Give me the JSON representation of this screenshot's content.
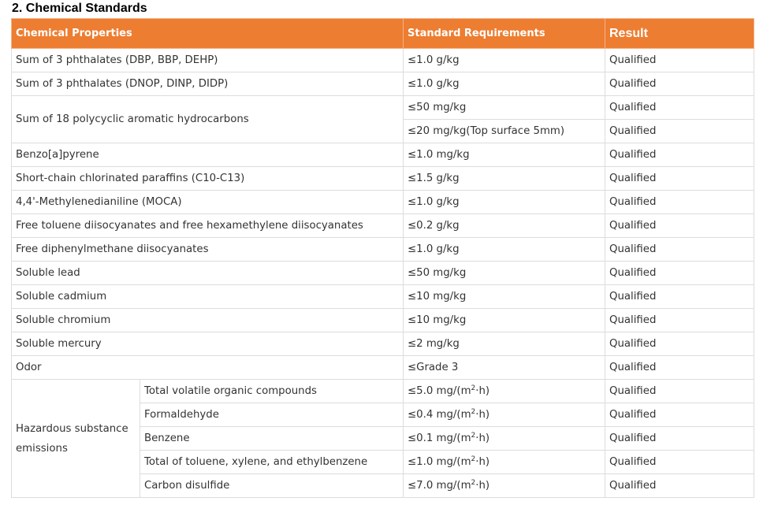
{
  "section_title": "2. Chemical Standards",
  "headers": {
    "property": "Chemical Properties",
    "requirement": "Standard Requirements",
    "result": "Result"
  },
  "rows": [
    {
      "property": "Sum of 3 phthalates (DBP, BBP, DEHP)",
      "requirement": "≤1.0 g/kg",
      "result": "Qualified"
    },
    {
      "property": "Sum of 3 phthalates (DNOP, DINP, DIDP)",
      "requirement": "≤1.0 g/kg",
      "result": "Qualified"
    },
    {
      "property": "Sum of 18 polycyclic aromatic hydrocarbons",
      "requirements": [
        {
          "requirement": "≤50 mg/kg",
          "result": "Qualified"
        },
        {
          "requirement": "≤20 mg/kg(Top surface 5mm)",
          "result": "Qualified"
        }
      ]
    },
    {
      "property": "Benzo[a]pyrene",
      "requirement": "≤1.0 mg/kg",
      "result": "Qualified"
    },
    {
      "property": "Short-chain chlorinated paraffins (C10-C13)",
      "requirement": "≤1.5 g/kg",
      "result": "Qualified"
    },
    {
      "property": "4,4'-Methylenedianiline (MOCA)",
      "requirement": "≤1.0 g/kg",
      "result": "Qualified"
    },
    {
      "property": "Free toluene diisocyanates and free hexamethylene diisocyanates",
      "requirement": "≤0.2 g/kg",
      "result": "Qualified"
    },
    {
      "property": "Free diphenylmethane diisocyanates",
      "requirement": "≤1.0 g/kg",
      "result": "Qualified"
    },
    {
      "property": "Soluble lead",
      "requirement": "≤50 mg/kg",
      "result": "Qualified"
    },
    {
      "property": "Soluble cadmium",
      "requirement": "≤10 mg/kg",
      "result": "Qualified"
    },
    {
      "property": "Soluble chromium",
      "requirement": "≤10 mg/kg",
      "result": "Qualified"
    },
    {
      "property": "Soluble mercury",
      "requirement": "≤2 mg/kg",
      "result": "Qualified"
    },
    {
      "property": "Odor",
      "requirement": "≤Grade 3",
      "result": "Qualified"
    }
  ],
  "emissions": {
    "group_label": "Hazardous substance emissions",
    "unit_exponent": "2",
    "items": [
      {
        "substance": "Total volatile organic compounds",
        "req_prefix": "≤5.0 mg/(m",
        "req_suffix": "·h)",
        "result": "Qualified"
      },
      {
        "substance": "Formaldehyde",
        "req_prefix": "≤0.4 mg/(m",
        "req_suffix": "·h)",
        "result": "Qualified"
      },
      {
        "substance": "Benzene",
        "req_prefix": "≤0.1 mg/(m",
        "req_suffix": "·h)",
        "result": "Qualified"
      },
      {
        "substance": "Total of toluene, xylene, and ethylbenzene",
        "req_prefix": "≤1.0 mg/(m",
        "req_suffix": "·h)",
        "result": "Qualified"
      },
      {
        "substance": "Carbon disulfide",
        "req_prefix": "≤7.0 mg/(m",
        "req_suffix": "·h)",
        "result": "Qualified"
      }
    ]
  },
  "colors": {
    "header_bg": "#ed7d31",
    "header_text": "#ffffff",
    "border": "#dcdcdc"
  }
}
